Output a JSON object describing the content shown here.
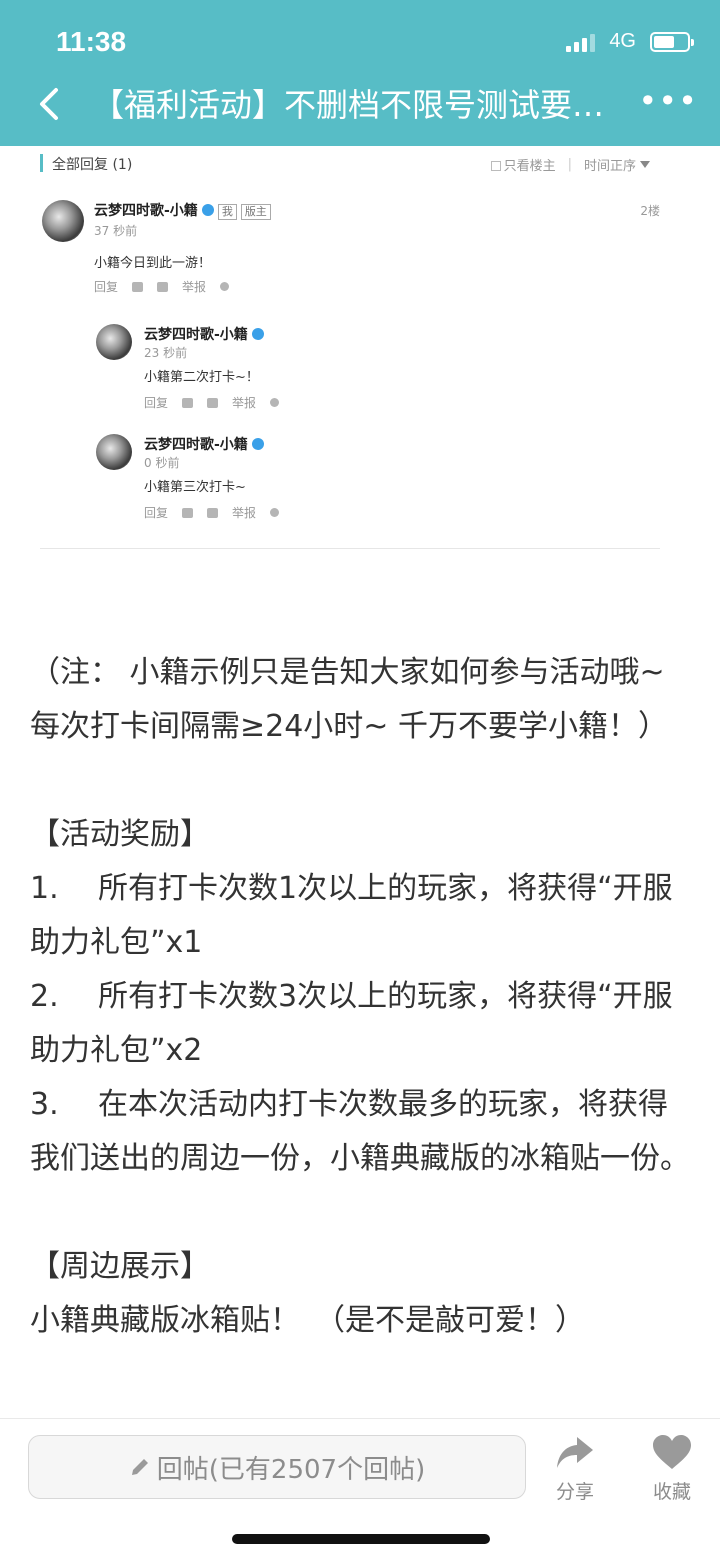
{
  "status_bar": {
    "time": "11:38",
    "network": "4G"
  },
  "nav": {
    "title": "【福利活动】不删档不限号测试要…",
    "more": "•••"
  },
  "embed": {
    "header_title": "全部回复 (1)",
    "filter_only_op": "只看楼主",
    "filter_sort": "时间正序",
    "comments": [
      {
        "name": "云梦四时歌-小籍",
        "tags": [
          "我",
          "版主"
        ],
        "time": "37 秒前",
        "text": "小籍今日到此一游！",
        "floor": "2楼",
        "reply": "回复",
        "report": "举报"
      },
      {
        "name": "云梦四时歌-小籍",
        "time": "23 秒前",
        "text": "小籍第二次打卡~！",
        "reply": "回复",
        "report": "举报"
      },
      {
        "name": "云梦四时歌-小籍",
        "time": "0 秒前",
        "text": "小籍第三次打卡~",
        "reply": "回复",
        "report": "举报"
      }
    ]
  },
  "content": {
    "note": "（注： 小籍示例只是告知大家如何参与活动哦~ 每次打卡间隔需≥24小时~ 千万不要学小籍！）",
    "reward_heading": "【活动奖励】",
    "rewards": [
      {
        "num": "1.",
        "text": "所有打卡次数1次以上的玩家，将获得“开服助力礼包”x1"
      },
      {
        "num": "2.",
        "text": "所有打卡次数3次以上的玩家，将获得“开服助力礼包”x2"
      },
      {
        "num": "3.",
        "text": "在本次活动内打卡次数最多的玩家，将获得我们送出的周边一份，小籍典藏版的冰箱贴一份。"
      }
    ],
    "merch_heading": "【周边展示】",
    "merch_line": "小籍典藏版冰箱贴！　（是不是敲可爱！）"
  },
  "bottom_bar": {
    "reply_placeholder": "回帖(已有2507个回帖)",
    "share_label": "分享",
    "collect_label": "收藏"
  },
  "colors": {
    "header_bg": "#57bdc6",
    "badge_blue": "#3aa0e8"
  }
}
